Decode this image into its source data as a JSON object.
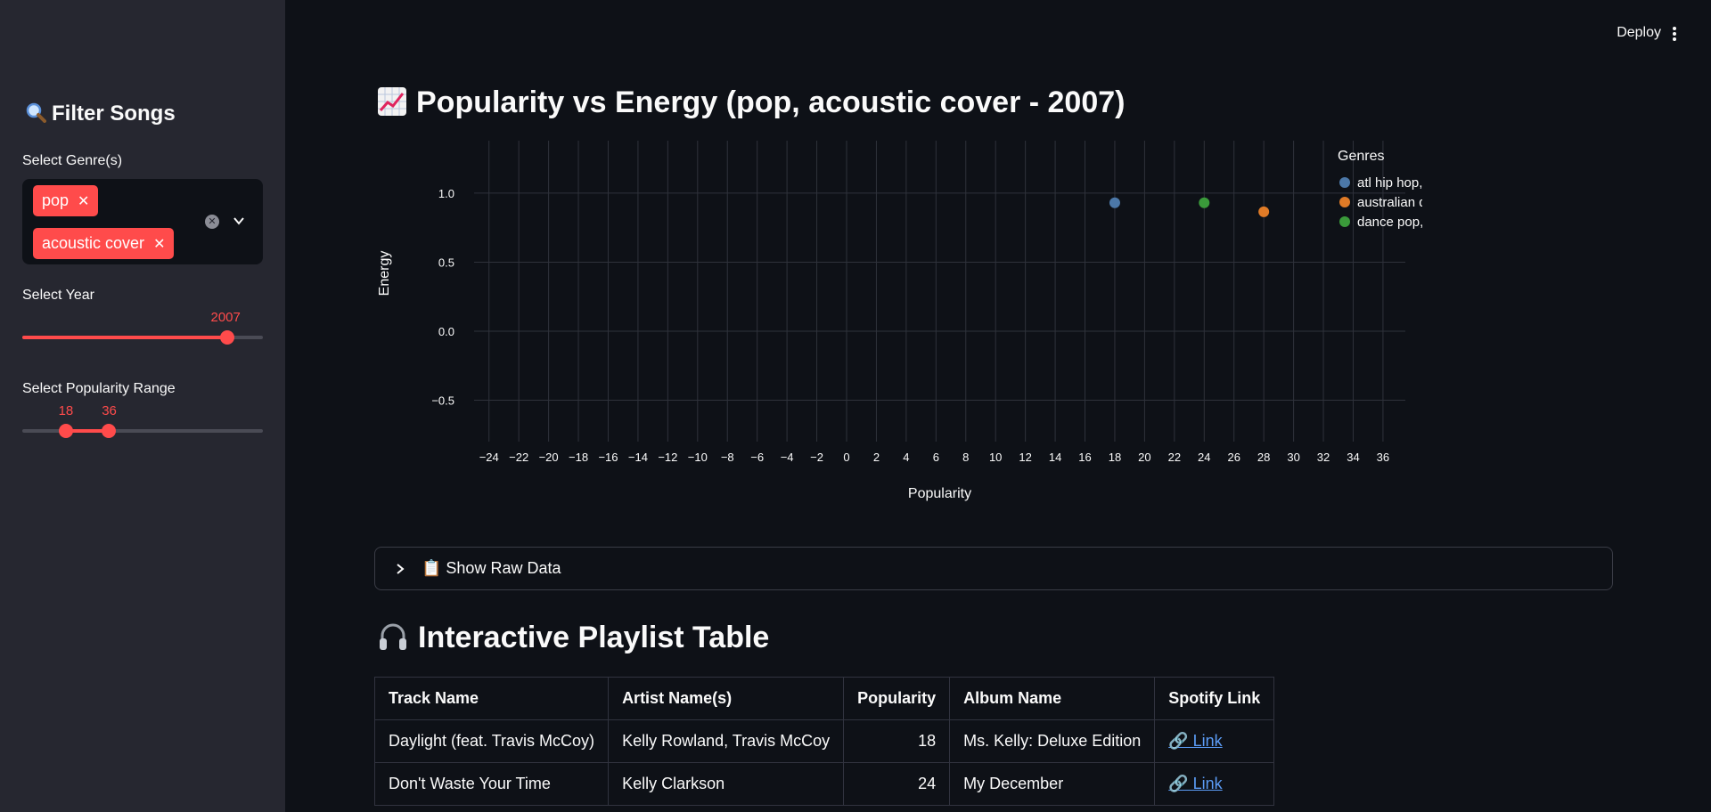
{
  "app": {
    "deploy_label": "Deploy"
  },
  "sidebar": {
    "title": "Filter Songs",
    "genre_label": "Select Genre(s)",
    "genres_selected": [
      "pop",
      "acoustic cover"
    ],
    "year_label": "Select Year",
    "year_value": "2007",
    "year_fraction": 0.85,
    "pop_label": "Select Popularity Range",
    "pop_min": "18",
    "pop_max": "36",
    "pop_min_fraction": 0.18,
    "pop_max_fraction": 0.36
  },
  "chart_title": "Popularity vs Energy (pop, acoustic cover - 2007)",
  "chart_data": {
    "type": "scatter",
    "xlabel": "Popularity",
    "ylabel": "Energy",
    "xlim": [
      -25,
      37.5
    ],
    "ylim": [
      -0.8,
      1.38
    ],
    "xticks": [
      -24,
      -22,
      -20,
      -18,
      -16,
      -14,
      -12,
      -10,
      -8,
      -6,
      -4,
      -2,
      0,
      2,
      4,
      6,
      8,
      10,
      12,
      14,
      16,
      18,
      20,
      22,
      24,
      26,
      28,
      30,
      32,
      34,
      36
    ],
    "yticks": [
      -0.5,
      0.0,
      0.5,
      1.0
    ],
    "ytick_labels": [
      "−0.5",
      "0.0",
      "0.5",
      "1.0"
    ],
    "legend_title": "Genres",
    "legend_position": "right",
    "grid": true,
    "series": [
      {
        "name": "atl hip hop,dance pop,hi…",
        "color": "#4c78a8",
        "points": [
          [
            18,
            0.93
          ]
        ]
      },
      {
        "name": "australian dance,australi…",
        "color": "#e07b27",
        "points": [
          [
            28,
            0.865
          ]
        ]
      },
      {
        "name": "dance pop,pop,talent show",
        "color": "#3a9a3a",
        "points": [
          [
            24,
            0.93
          ]
        ]
      }
    ]
  },
  "expander": {
    "label": "📋 Show Raw Data"
  },
  "table_title": "Interactive Playlist Table",
  "table": {
    "headers": [
      "Track Name",
      "Artist Name(s)",
      "Popularity",
      "Album Name",
      "Spotify Link"
    ],
    "rows": [
      [
        "Daylight (feat. Travis McCoy)",
        "Kelly Rowland, Travis McCoy",
        "18",
        "Ms. Kelly: Deluxe Edition",
        "🔗 Link"
      ],
      [
        "Don't Waste Your Time",
        "Kelly Clarkson",
        "24",
        "My December",
        "🔗 Link"
      ]
    ]
  }
}
